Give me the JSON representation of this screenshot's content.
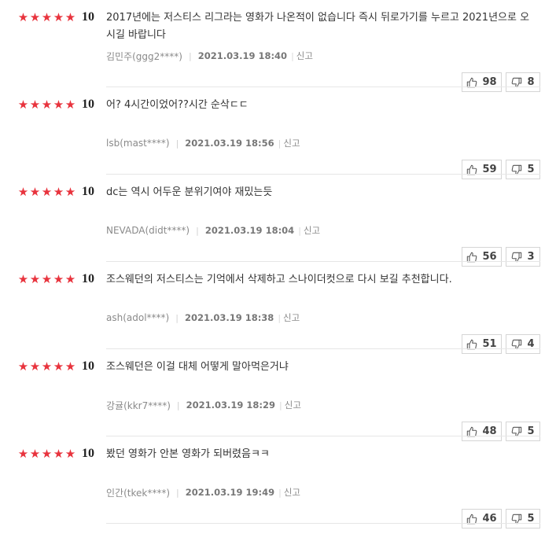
{
  "reviews": [
    {
      "stars": 5,
      "score": "10",
      "text": "2017년에는 저스티스 리그라는 영화가 나온적이 없습니다 즉시 뒤로가기를 누르고 2021년으로 오시길 바랍니다",
      "author": "김민주(ggg2****)",
      "date": "2021.03.19 18:40",
      "report": "신고",
      "likes": "98",
      "dislikes": "8"
    },
    {
      "stars": 5,
      "score": "10",
      "text": "어? 4시간이었어??시간 순삭ㄷㄷ",
      "author": "lsb(mast****)",
      "date": "2021.03.19 18:56",
      "report": "신고",
      "likes": "59",
      "dislikes": "5"
    },
    {
      "stars": 5,
      "score": "10",
      "text": "dc는 역시 어두운 분위기여야 재밌는듯",
      "author": "NEVADA(didt****)",
      "date": "2021.03.19 18:04",
      "report": "신고",
      "likes": "56",
      "dislikes": "3"
    },
    {
      "stars": 5,
      "score": "10",
      "text": "조스웨던의 저스티스는 기억에서 삭제하고 스나이더컷으로 다시 보길 추천합니다.",
      "author": "ash(adol****)",
      "date": "2021.03.19 18:38",
      "report": "신고",
      "likes": "51",
      "dislikes": "4"
    },
    {
      "stars": 5,
      "score": "10",
      "text": "조스웨던은 이걸 대체 어떻게 말아먹은거냐",
      "author": "강귤(kkr7****)",
      "date": "2021.03.19 18:29",
      "report": "신고",
      "likes": "48",
      "dislikes": "5"
    },
    {
      "stars": 5,
      "score": "10",
      "text": "봤던 영화가 안본 영화가 되버렸음ㅋㅋ",
      "author": "인간(tkek****)",
      "date": "2021.03.19 19:49",
      "report": "신고",
      "likes": "46",
      "dislikes": "5"
    }
  ],
  "icons": {
    "star": "star-icon",
    "like": "thumbs-up-icon",
    "dislike": "thumbs-down-icon"
  },
  "colors": {
    "star": "#e8333d"
  }
}
